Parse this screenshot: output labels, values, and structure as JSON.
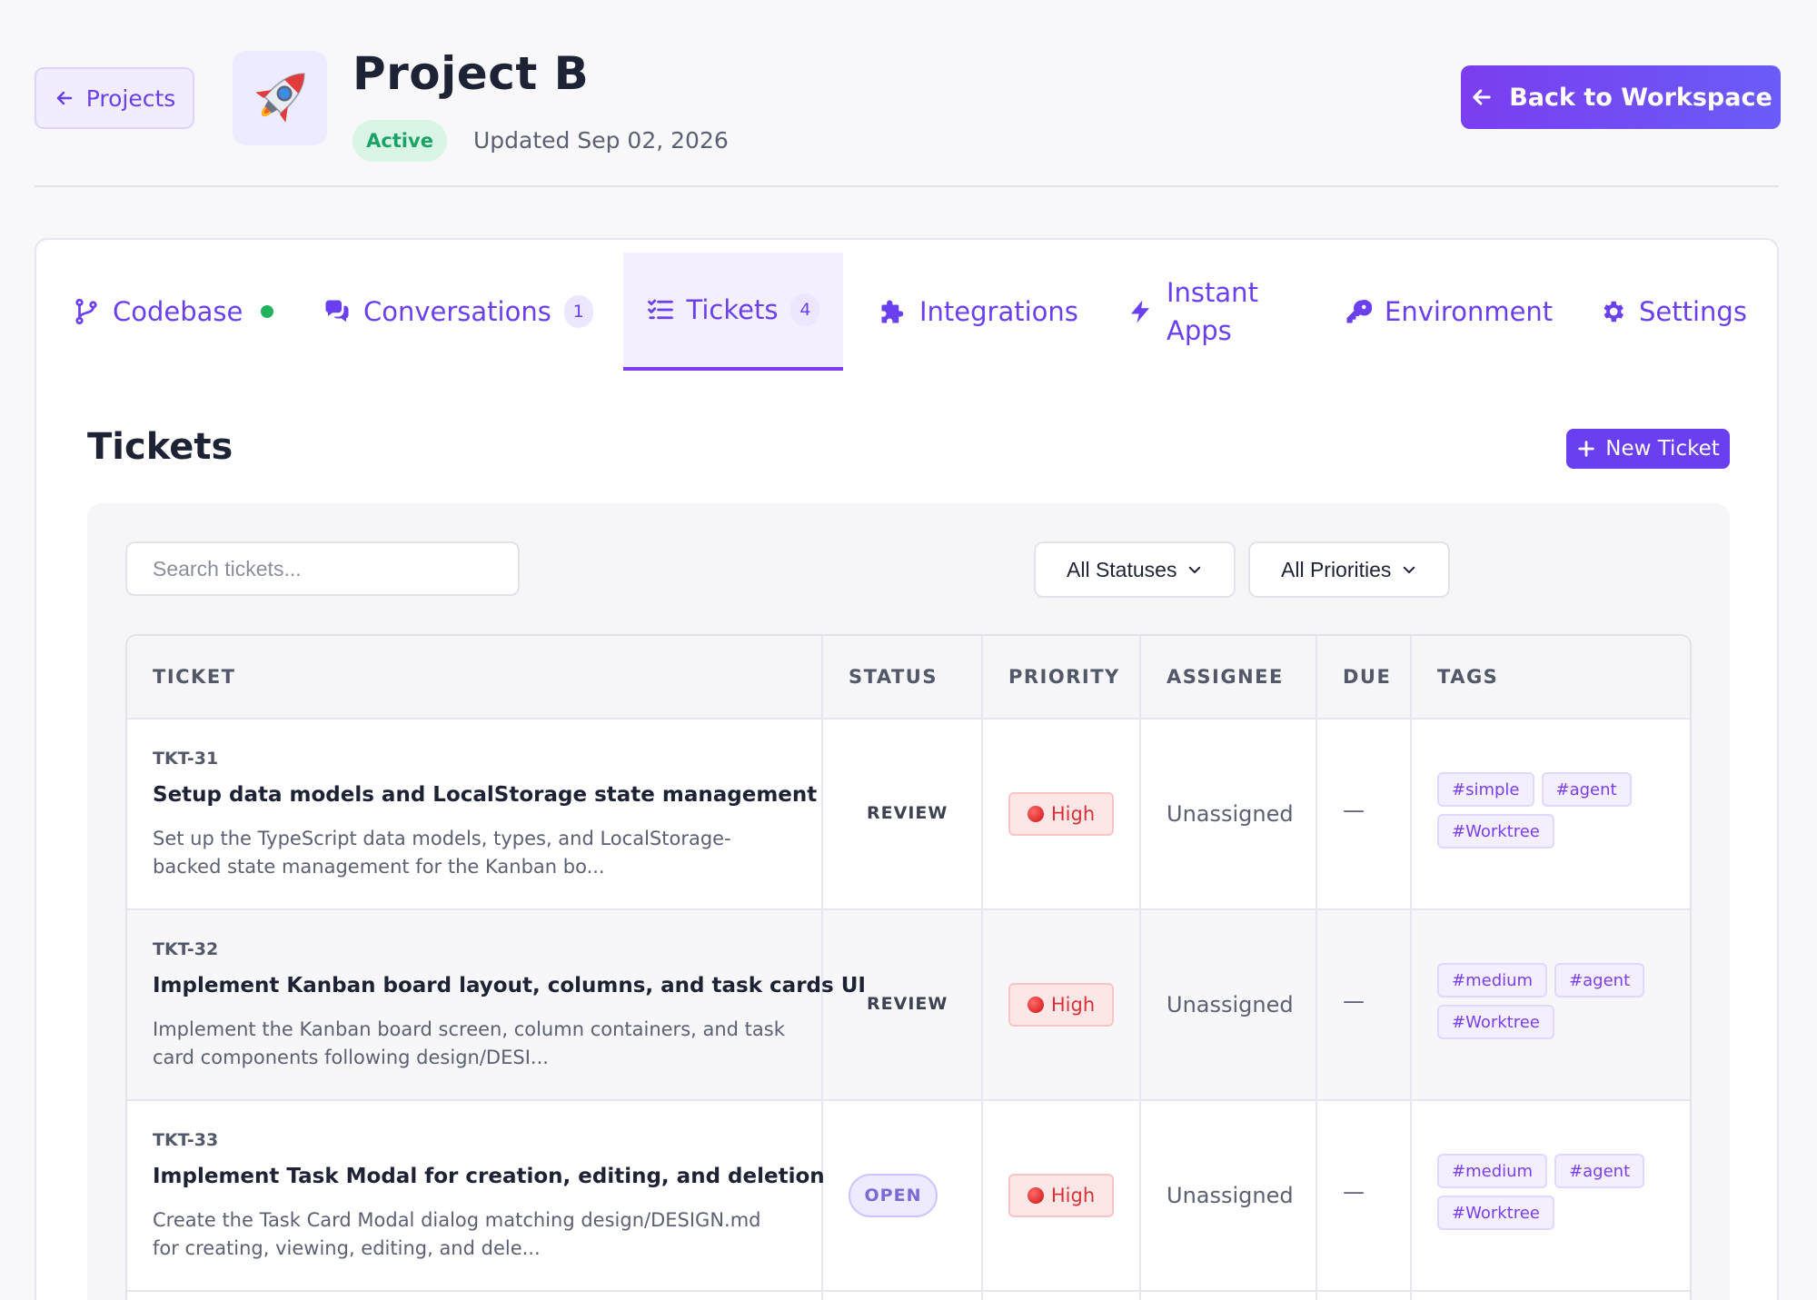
{
  "header": {
    "back_label": "Projects",
    "project_title": "Project B",
    "status": "Active",
    "updated": "Updated Sep 02, 2026",
    "back_workspace_label": "Back to Workspace"
  },
  "tabs": [
    {
      "label": "Codebase",
      "icon": "git-branch-icon"
    },
    {
      "label": "Conversations",
      "icon": "chat-icon",
      "count": "1"
    },
    {
      "label": "Tickets",
      "icon": "list-check-icon",
      "count": "4",
      "active": true
    },
    {
      "label": "Integrations",
      "icon": "puzzle-icon"
    },
    {
      "label_line1": "Instant",
      "label_line2": "Apps",
      "icon": "bolt-icon"
    },
    {
      "label": "Environment",
      "icon": "key-icon"
    },
    {
      "label": "Settings",
      "icon": "gear-icon"
    }
  ],
  "tickets_section": {
    "title": "Tickets",
    "new_ticket_label": "New Ticket",
    "search_placeholder": "Search tickets...",
    "status_filter": "All Statuses",
    "priority_filter": "All Priorities"
  },
  "table": {
    "headers": [
      "TICKET",
      "STATUS",
      "PRIORITY",
      "ASSIGNEE",
      "DUE",
      "TAGS"
    ],
    "rows": [
      {
        "id": "TKT-31",
        "title": "Setup data models and LocalStorage state management",
        "description": "Set up the TypeScript data models, types, and LocalStorage-backed state management for the Kanban bo...",
        "status": "REVIEW",
        "priority": "High",
        "assignee": "Unassigned",
        "due": "—",
        "tags": [
          "#simple",
          "#agent",
          "#Worktree"
        ]
      },
      {
        "id": "TKT-32",
        "title": "Implement Kanban board layout, columns, and task cards UI",
        "description": "Implement the Kanban board screen, column containers, and task card components following design/DESI...",
        "status": "REVIEW",
        "priority": "High",
        "assignee": "Unassigned",
        "due": "—",
        "tags": [
          "#medium",
          "#agent",
          "#Worktree"
        ]
      },
      {
        "id": "TKT-33",
        "title": "Implement Task Modal for creation, editing, and deletion",
        "description": "Create the Task Card Modal dialog matching design/DESIGN.md for creating, viewing, editing, and dele...",
        "status": "OPEN",
        "priority": "High",
        "assignee": "Unassigned",
        "due": "—",
        "tags": [
          "#medium",
          "#agent",
          "#Worktree"
        ]
      }
    ]
  },
  "colors": {
    "accent": "#6a3ff0",
    "active_green": "#1aa365",
    "priority_high": "#d8313a"
  }
}
